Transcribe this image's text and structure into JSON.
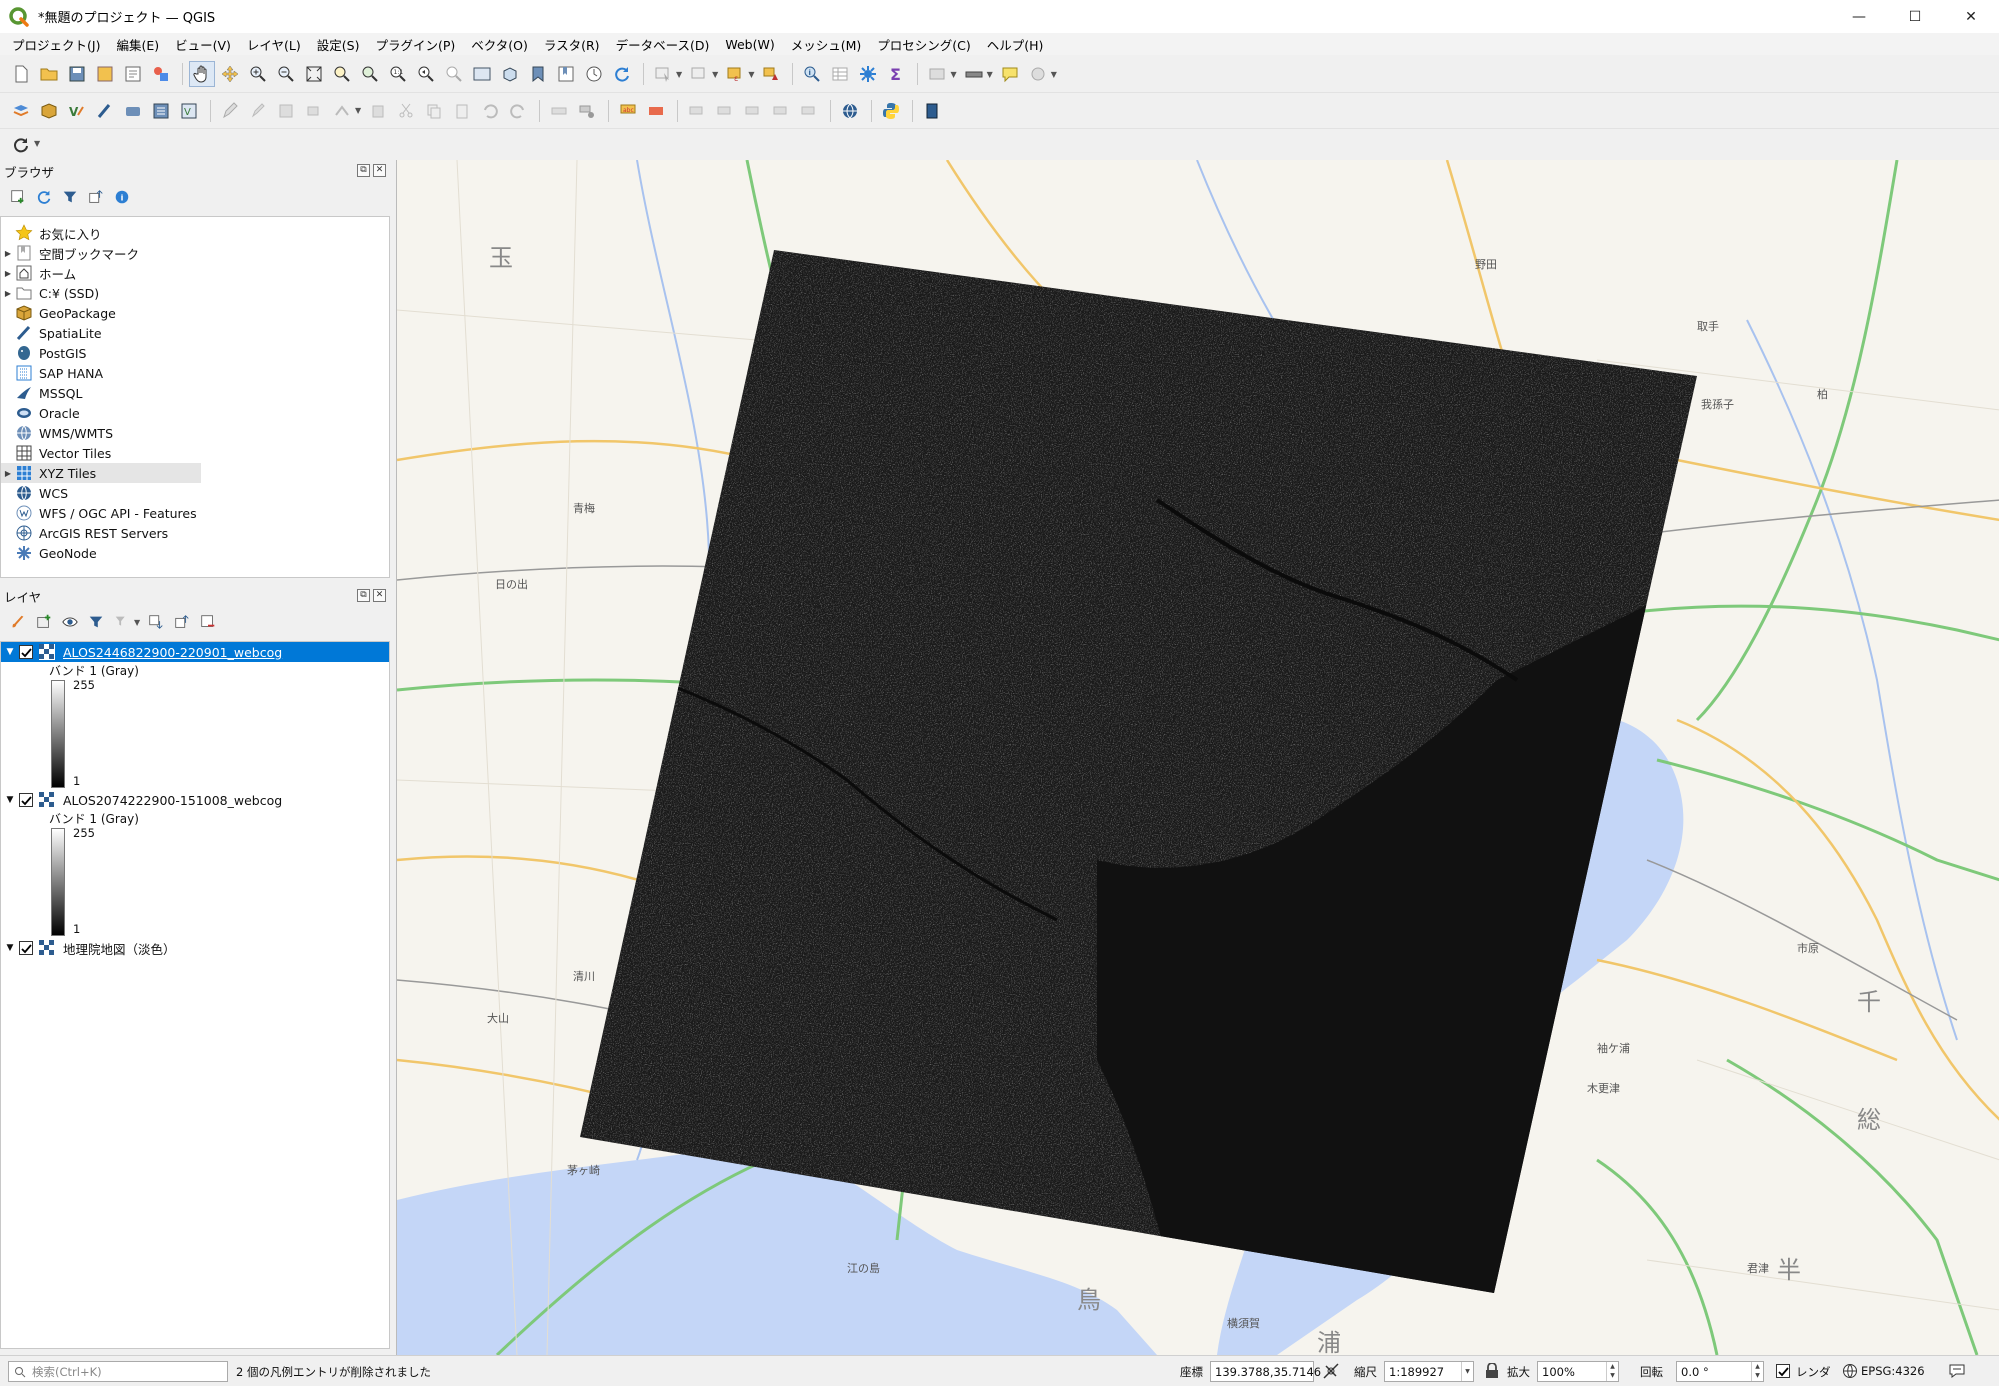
{
  "window": {
    "title": "*無題のプロジェクト — QGIS",
    "minimize_glyph": "—",
    "maximize_glyph": "☐",
    "close_glyph": "✕"
  },
  "menus": [
    "プロジェクト(J)",
    "編集(E)",
    "ビュー(V)",
    "レイヤ(L)",
    "設定(S)",
    "プラグイン(P)",
    "ベクタ(O)",
    "ラスタ(R)",
    "データベース(D)",
    "Web(W)",
    "メッシュ(M)",
    "プロセシング(C)",
    "ヘルプ(H)"
  ],
  "browser": {
    "title": "ブラウザ",
    "items": [
      {
        "label": "お気に入り",
        "icon": "star-icon",
        "expandable": false
      },
      {
        "label": "空間ブックマーク",
        "icon": "bookmark-icon",
        "expandable": true
      },
      {
        "label": "ホーム",
        "icon": "home-icon",
        "expandable": true
      },
      {
        "label": "C:¥ (SSD)",
        "icon": "drive-icon",
        "expandable": true
      },
      {
        "label": "GeoPackage",
        "icon": "geopackage-icon",
        "expandable": false
      },
      {
        "label": "SpatiaLite",
        "icon": "spatialite-icon",
        "expandable": false
      },
      {
        "label": "PostGIS",
        "icon": "postgis-icon",
        "expandable": false
      },
      {
        "label": "SAP HANA",
        "icon": "sap-hana-icon",
        "expandable": false
      },
      {
        "label": "MSSQL",
        "icon": "mssql-icon",
        "expandable": false
      },
      {
        "label": "Oracle",
        "icon": "oracle-icon",
        "expandable": false
      },
      {
        "label": "WMS/WMTS",
        "icon": "wms-icon",
        "expandable": false
      },
      {
        "label": "Vector Tiles",
        "icon": "vector-tiles-icon",
        "expandable": false
      },
      {
        "label": "XYZ Tiles",
        "icon": "xyz-tiles-icon",
        "expandable": true,
        "selected": true
      },
      {
        "label": "WCS",
        "icon": "wcs-icon",
        "expandable": false
      },
      {
        "label": "WFS / OGC API - Features",
        "icon": "wfs-icon",
        "expandable": false
      },
      {
        "label": "ArcGIS REST Servers",
        "icon": "arcgis-icon",
        "expandable": false
      },
      {
        "label": "GeoNode",
        "icon": "geonode-icon",
        "expandable": false
      }
    ]
  },
  "layers": {
    "title": "レイヤ",
    "items": [
      {
        "name": "ALOS2446822900-220901_webcog",
        "band": "バンド 1 (Gray)",
        "max": "255",
        "min": "1",
        "selected": true
      },
      {
        "name": "ALOS2074222900-151008_webcog",
        "band": "バンド 1 (Gray)",
        "max": "255",
        "min": "1",
        "selected": false
      },
      {
        "name": "地理院地図（淡色）"
      }
    ]
  },
  "map_labels": [
    {
      "text": "玉"
    },
    {
      "text": "青梅"
    },
    {
      "text": "日の出"
    },
    {
      "text": "大山"
    },
    {
      "text": "清川"
    },
    {
      "text": "野田"
    },
    {
      "text": "取手"
    },
    {
      "text": "我孫子"
    },
    {
      "text": "柏"
    },
    {
      "text": "市原"
    },
    {
      "text": "千"
    },
    {
      "text": "半"
    },
    {
      "text": "総"
    },
    {
      "text": "浦"
    },
    {
      "text": "鳥"
    },
    {
      "text": "木更津"
    },
    {
      "text": "君津"
    },
    {
      "text": "袖ケ浦"
    },
    {
      "text": "江の島"
    },
    {
      "text": "茅ヶ崎"
    },
    {
      "text": "横須賀"
    }
  ],
  "status": {
    "search_placeholder": "検索(Ctrl+K)",
    "message": "2 個の凡例エントリが削除されました",
    "coord_label": "座標",
    "coord_value": "139.3788,35.7146",
    "scale_label": "縮尺",
    "scale_value": "1:189927",
    "magnifier_label": "拡大",
    "magnifier_value": "100%",
    "rotation_label": "回転",
    "rotation_value": "0.0 °",
    "render_label": "レンダ",
    "crs_label": "EPSG:4326"
  },
  "colors": {
    "accent": "#0078d7",
    "water": "#c4d6f7",
    "land": "#f6f4ee",
    "sar_image": "#1a1a1a"
  }
}
